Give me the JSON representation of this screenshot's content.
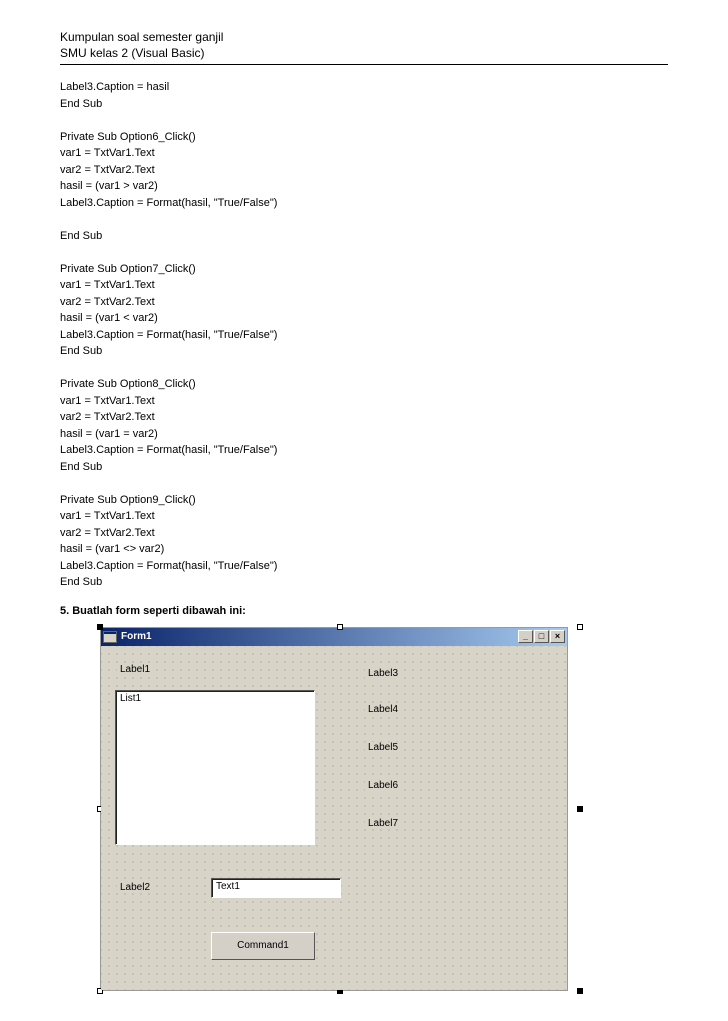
{
  "header": {
    "title": "Kumpulan soal semester ganjil",
    "subtitle": "SMU kelas 2 (Visual Basic)"
  },
  "code": "Label3.Caption = hasil\nEnd Sub\n\nPrivate Sub Option6_Click()\nvar1 = TxtVar1.Text\nvar2 = TxtVar2.Text\nhasil = (var1 > var2)\nLabel3.Caption = Format(hasil, \"True/False\")\n\nEnd Sub\n\nPrivate Sub Option7_Click()\nvar1 = TxtVar1.Text\nvar2 = TxtVar2.Text\nhasil = (var1 < var2)\nLabel3.Caption = Format(hasil, \"True/False\")\nEnd Sub\n\nPrivate Sub Option8_Click()\nvar1 = TxtVar1.Text\nvar2 = TxtVar2.Text\nhasil = (var1 = var2)\nLabel3.Caption = Format(hasil, \"True/False\")\nEnd Sub\n\nPrivate Sub Option9_Click()\nvar1 = TxtVar1.Text\nvar2 = TxtVar2.Text\nhasil = (var1 <> var2)\nLabel3.Caption = Format(hasil, \"True/False\")\nEnd Sub",
  "question": "5. Buatlah form seperti dibawah ini:",
  "form": {
    "title": "Form1",
    "label1": "Label1",
    "label2": "Label2",
    "label3": "Label3",
    "label4": "Label4",
    "label5": "Label5",
    "label6": "Label6",
    "label7": "Label7",
    "list1": "List1",
    "text1": "Text1",
    "command1": "Command1",
    "win": {
      "minimize": "_",
      "maximize": "□",
      "close": "×"
    }
  }
}
